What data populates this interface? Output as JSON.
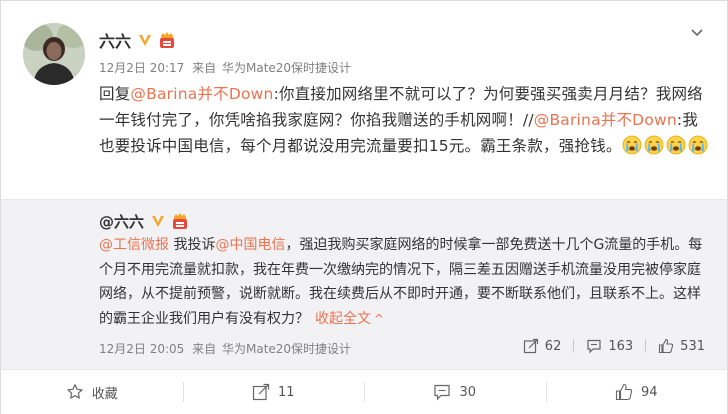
{
  "post": {
    "author": "六六",
    "meta": {
      "date": "12月2日 20:17",
      "source_prefix": "来自",
      "source": "华为Mate20保时捷设计"
    },
    "content": {
      "p1": "回复",
      "mention1": "@Barina并不Down",
      "p2": ":你直接加网络里不就可以了？为何要强买强卖月月结？我网络一年钱付完了，你凭啥掐我家庭网？你掐我赠送的手机网啊！//",
      "mention2": "@Barina并不Down",
      "p3": ":我也要投诉中国电信，每个月都说没用完流量要扣15元。霸王条款，强抢钱。"
    },
    "emoji_names": [
      "crying-face-icon",
      "crying-face-icon",
      "crying-face-icon",
      "crying-face-icon"
    ]
  },
  "repost": {
    "author": "@六六",
    "text": {
      "m1": "@工信微报",
      "t1": " 我投诉",
      "m2": "@中国电信",
      "t2": "，强迫我购买家庭网络的时候拿一部免费送十几个G流量的手机。每个月不用完流量就扣款，我在年费一次缴纳完的情况下，隔三差五因赠送手机流量没用完被停家庭网络，从不提前预警，说断就断。我在续费后从不即时开通，要不断联系他们，且联系不上。这样的霸王企业我们用户有没有权力？",
      "collapse": "收起全文",
      "collapse_arrow": "^"
    },
    "meta": {
      "date": "12月2日 20:05",
      "source_prefix": "来自",
      "source": "华为Mate20保时捷设计"
    },
    "stats": {
      "shares": "62",
      "comments": "163",
      "likes": "531"
    }
  },
  "actions": {
    "favorite": "收藏",
    "share": "11",
    "comment": "30",
    "like": "94"
  },
  "colors": {
    "link": "#eb7350",
    "badge_gold": "#f5a623",
    "repost_bg": "#f2f2f5"
  }
}
